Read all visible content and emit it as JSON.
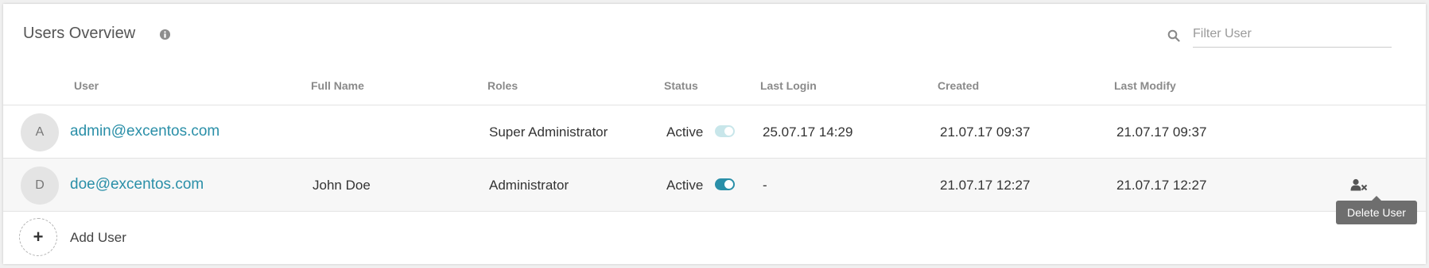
{
  "header": {
    "title": "Users Overview",
    "info_icon": "info-circle-icon",
    "search_icon": "search-icon",
    "filter_placeholder": "Filter User",
    "filter_value": ""
  },
  "columns": [
    "User",
    "Full Name",
    "Roles",
    "Status",
    "Last Login",
    "Created",
    "Last Modify"
  ],
  "users": [
    {
      "avatar": "A",
      "email": "admin@excentos.com",
      "full_name": "",
      "role": "Super Administrator",
      "status": "Active",
      "status_enabled": false,
      "last_login": "25.07.17 14:29",
      "created": "21.07.17 09:37",
      "last_modify": "21.07.17 09:37"
    },
    {
      "avatar": "D",
      "email": "doe@excentos.com",
      "full_name": "John Doe",
      "role": "Administrator",
      "status": "Active",
      "status_enabled": true,
      "last_login": "-",
      "created": "21.07.17 12:27",
      "last_modify": "21.07.17 12:27"
    }
  ],
  "row_action": {
    "icon": "delete-user-icon",
    "tooltip": "Delete User"
  },
  "add_user": {
    "icon": "plus-icon",
    "label": "Add User"
  },
  "colors": {
    "accent": "#2a8fa8",
    "toggle_off": "#c8e6ea",
    "tooltip_bg": "#6e6e6e"
  }
}
